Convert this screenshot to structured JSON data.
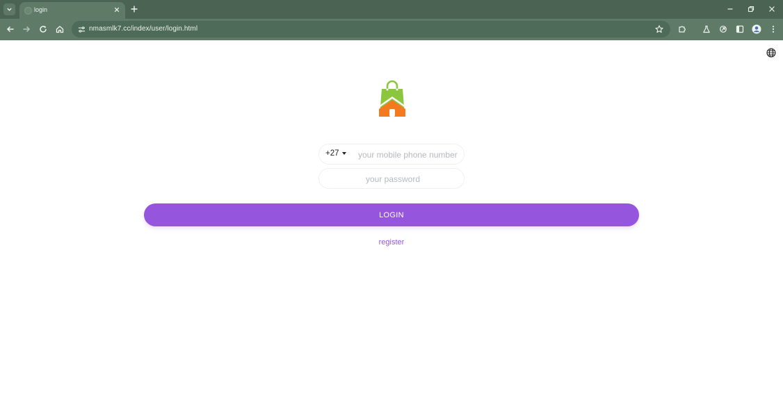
{
  "browser": {
    "tab": {
      "title": "login"
    },
    "address_bar": {
      "url": "nmasmlk7.cc/index/user/login.html"
    }
  },
  "page": {
    "phone": {
      "country_code": "+27",
      "placeholder": "your mobile phone number"
    },
    "password": {
      "placeholder": "your password"
    },
    "login_label": "LOGIN",
    "register_label": "register"
  },
  "colors": {
    "accent": "#9556dd",
    "chrome_dark": "#4a6352",
    "chrome_light": "#5f7b68",
    "logo_bag": "#8cc63f",
    "logo_house": "#f47a20"
  },
  "icons": {
    "tab_search": "chevron-down-icon",
    "tab_close": "close-icon",
    "new_tab": "plus-icon",
    "back": "arrow-left-icon",
    "forward": "arrow-right-icon",
    "reload": "reload-icon",
    "home": "home-icon",
    "site_info": "tune-icon",
    "bookmark": "star-icon",
    "extensions": "puzzle-icon",
    "labs": "flask-icon",
    "sync": "sync-icon",
    "side_panel": "side-panel-icon",
    "profile": "avatar-icon",
    "menu": "kebab-menu-icon",
    "language": "globe-icon"
  }
}
